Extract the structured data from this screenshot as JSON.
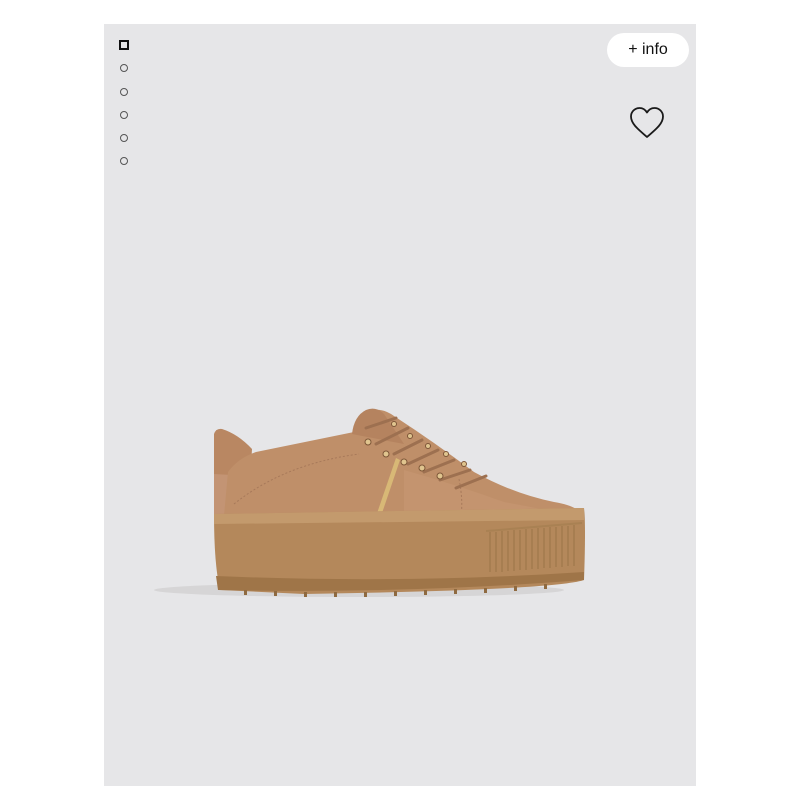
{
  "product_viewer": {
    "image_count": 6,
    "active_image_index": 0,
    "info_button_label": "+ info",
    "favorite_icon": "heart-outline-icon",
    "product_image": "tan-suede-platform-sneaker",
    "colors": {
      "panel_background": "#e6e6e8",
      "suede": "#bf8f69",
      "sole": "#b4885b",
      "metallic_stripe": "#d8b876"
    }
  }
}
